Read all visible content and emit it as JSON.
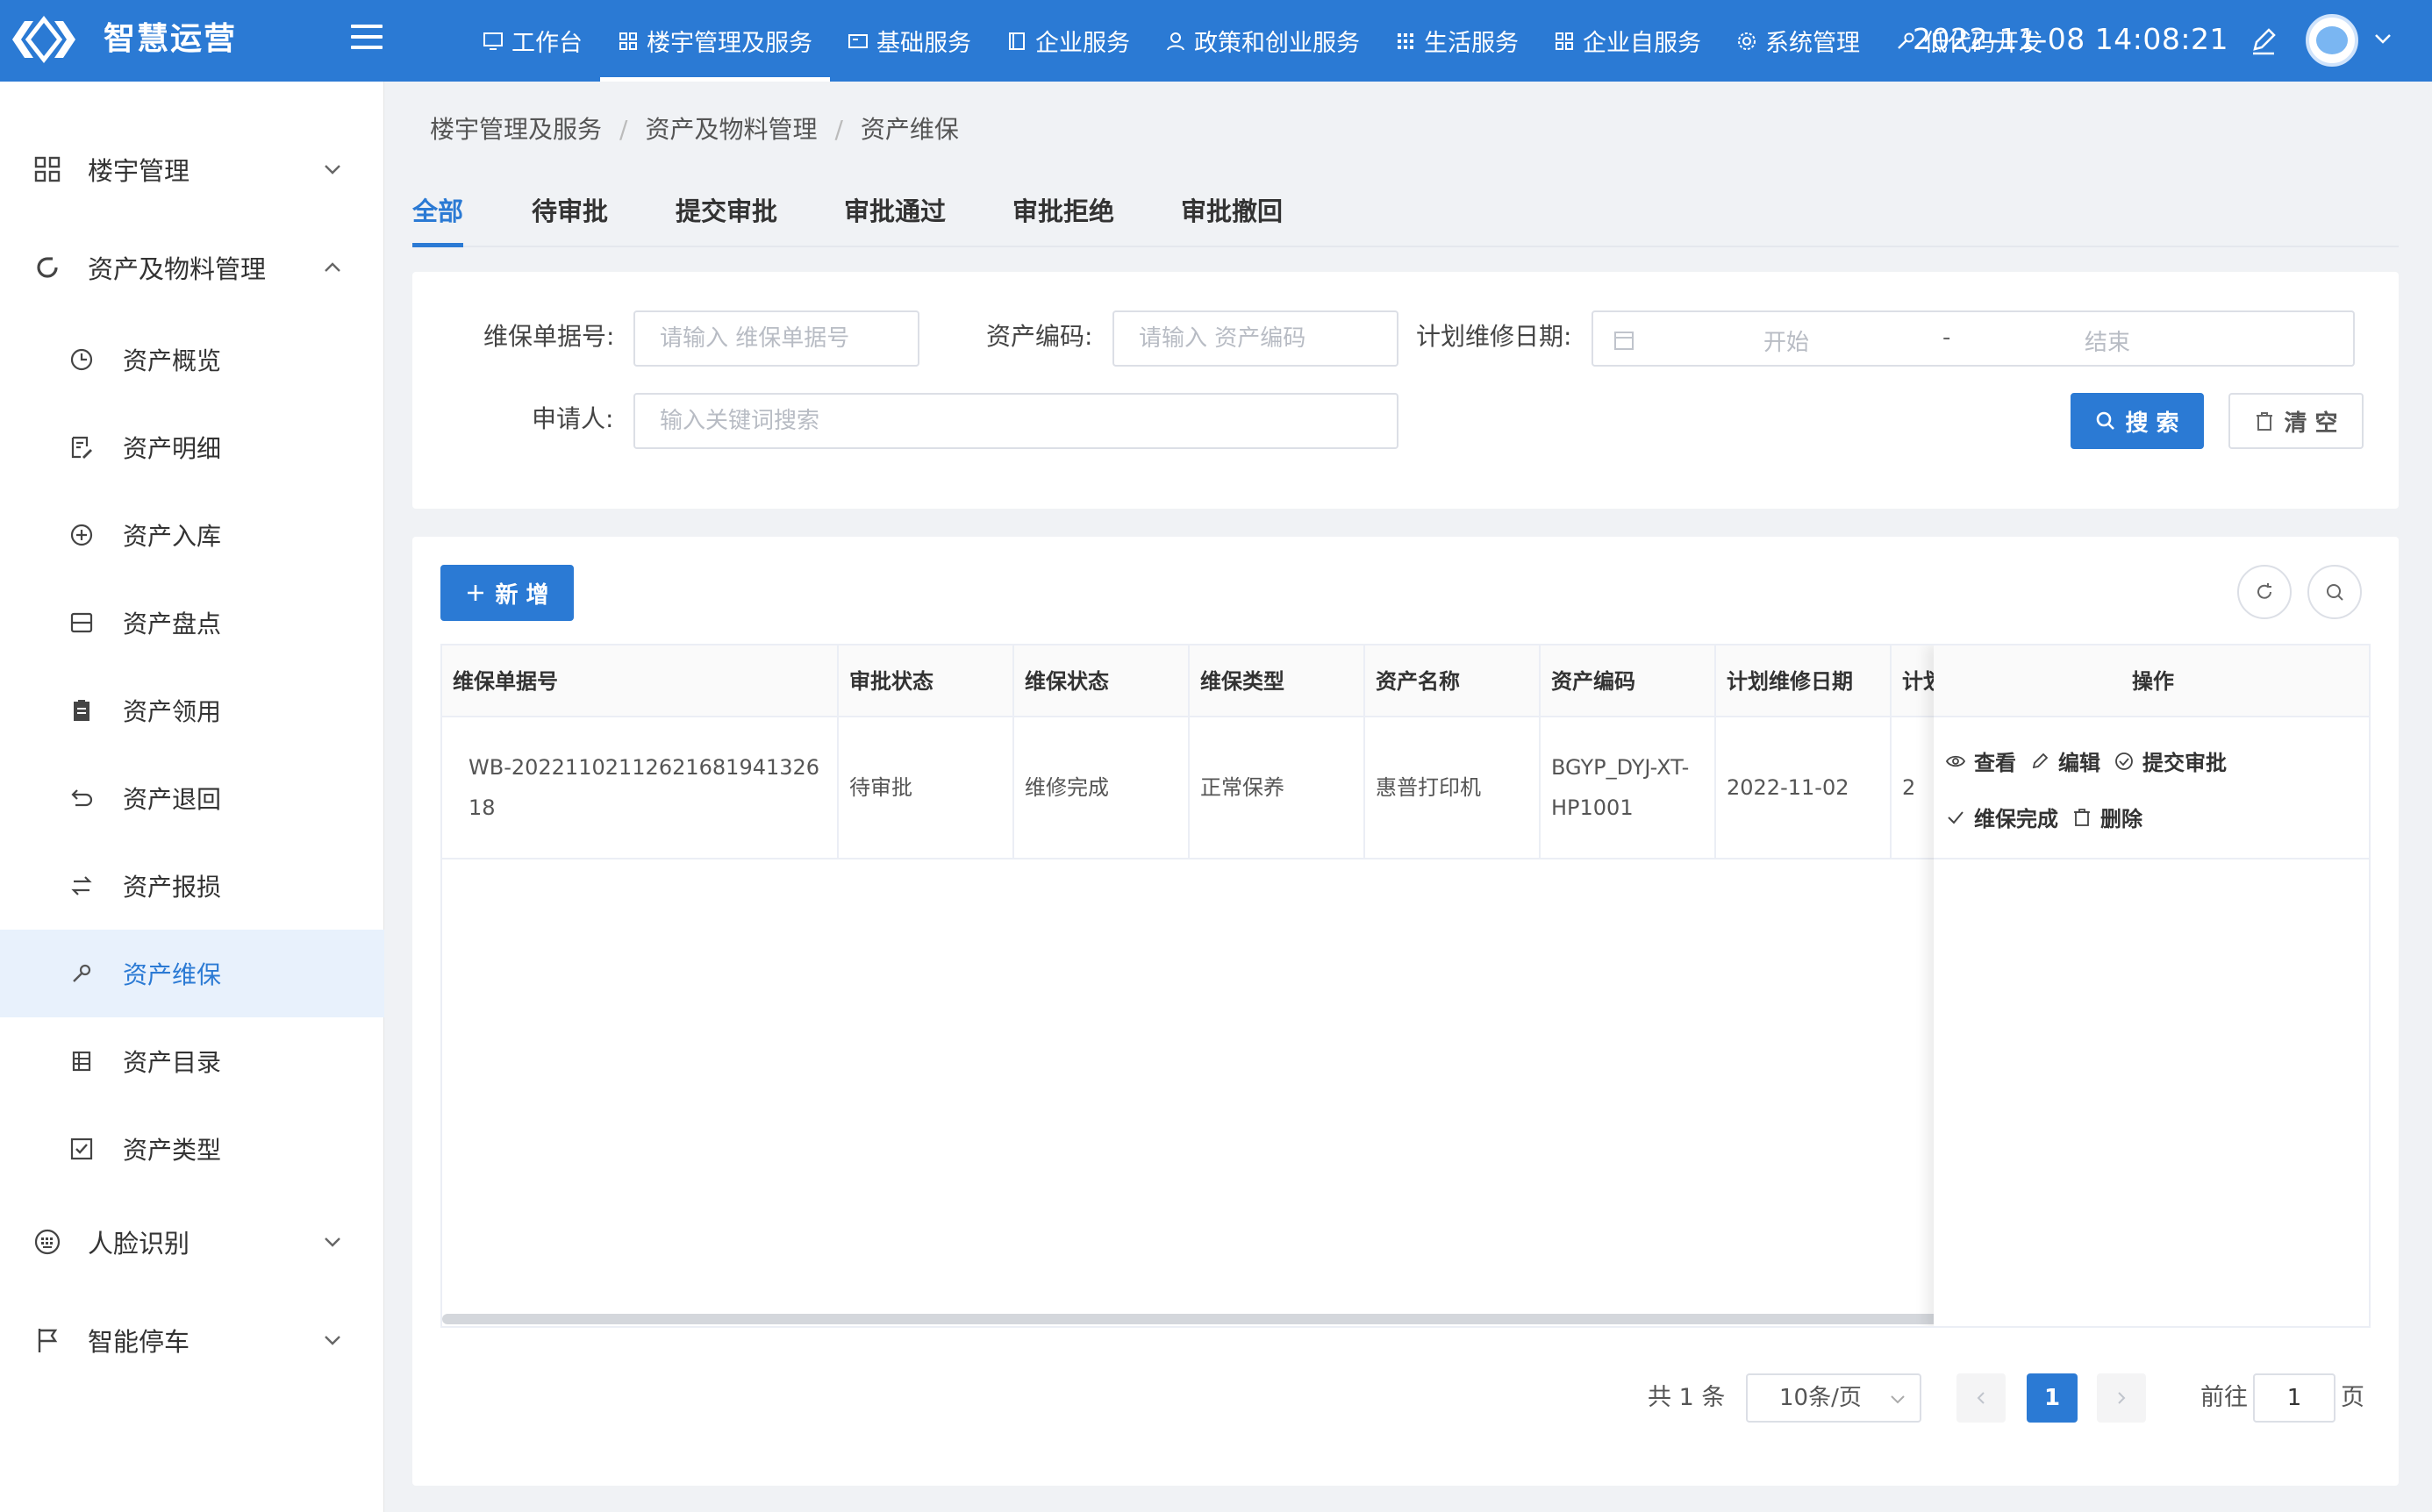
{
  "app": {
    "brand": "智慧运营",
    "clock": "2022-11-08 14:08:21"
  },
  "nav": [
    {
      "label": "工作台",
      "icon": "monitor-icon"
    },
    {
      "label": "楼宇管理及服务",
      "icon": "grid-icon",
      "active": true
    },
    {
      "label": "基础服务",
      "icon": "card-icon"
    },
    {
      "label": "企业服务",
      "icon": "book-icon"
    },
    {
      "label": "政策和创业服务",
      "icon": "user-icon"
    },
    {
      "label": "生活服务",
      "icon": "dots-grid-icon"
    },
    {
      "label": "企业自服务",
      "icon": "grid-icon"
    },
    {
      "label": "系统管理",
      "icon": "gear-icon"
    },
    {
      "label": "低代码开发",
      "icon": "wrench-icon"
    }
  ],
  "sidebar": {
    "groups": [
      {
        "label": "楼宇管理",
        "icon": "grid-icon",
        "expanded": false
      },
      {
        "label": "资产及物料管理",
        "icon": "refresh-icon",
        "expanded": true
      },
      {
        "label": "人脸识别",
        "icon": "keyboard-icon",
        "expanded": false
      },
      {
        "label": "智能停车",
        "icon": "flag-icon",
        "expanded": false
      }
    ],
    "items": [
      {
        "label": "资产概览",
        "icon": "clock-icon"
      },
      {
        "label": "资产明细",
        "icon": "edit-doc-icon"
      },
      {
        "label": "资产入库",
        "icon": "plus-circle-icon"
      },
      {
        "label": "资产盘点",
        "icon": "box-icon"
      },
      {
        "label": "资产领用",
        "icon": "clipboard-icon"
      },
      {
        "label": "资产退回",
        "icon": "return-icon"
      },
      {
        "label": "资产报损",
        "icon": "swap-icon"
      },
      {
        "label": "资产维保",
        "icon": "wrench-icon",
        "active": true
      },
      {
        "label": "资产目录",
        "icon": "list-icon"
      },
      {
        "label": "资产类型",
        "icon": "checkbox-icon"
      }
    ]
  },
  "breadcrumb": [
    "楼宇管理及服务",
    "资产及物料管理",
    "资产维保"
  ],
  "tabs": [
    "全部",
    "待审批",
    "提交审批",
    "审批通过",
    "审批拒绝",
    "审批撤回"
  ],
  "filters": {
    "order_no_label": "维保单据号:",
    "order_no_placeholder": "请输入 维保单据号",
    "asset_code_label": "资产编码:",
    "asset_code_placeholder": "请输入 资产编码",
    "date_label": "计划维修日期:",
    "date_start": "开始",
    "date_sep": "-",
    "date_end": "结束",
    "applicant_label": "申请人:",
    "applicant_placeholder": "输入关键词搜索",
    "search_label": "搜 索",
    "clear_label": "清 空"
  },
  "toolbar": {
    "add_label": "新 增"
  },
  "table": {
    "columns": [
      "维保单据号",
      "审批状态",
      "维保状态",
      "维保类型",
      "资产名称",
      "资产编码",
      "计划维修日期",
      "计划",
      "操作"
    ],
    "rows": [
      {
        "order_no": "WB-20221102112621681941326 18",
        "approval_status": "待审批",
        "maint_status": "维修完成",
        "maint_type": "正常保养",
        "asset_name": "惠普打印机",
        "asset_code": "BGYP_DYJ-XT-HP1001",
        "plan_date": "2022-11-02",
        "plan_extra": "2"
      }
    ],
    "actions": [
      "查看",
      "编辑",
      "提交审批",
      "维保完成",
      "删除"
    ]
  },
  "pagination": {
    "total": "共 1 条",
    "page_size": "10条/页",
    "current": "1",
    "goto_label": "前往",
    "goto_value": "1",
    "page_suffix": "页"
  }
}
